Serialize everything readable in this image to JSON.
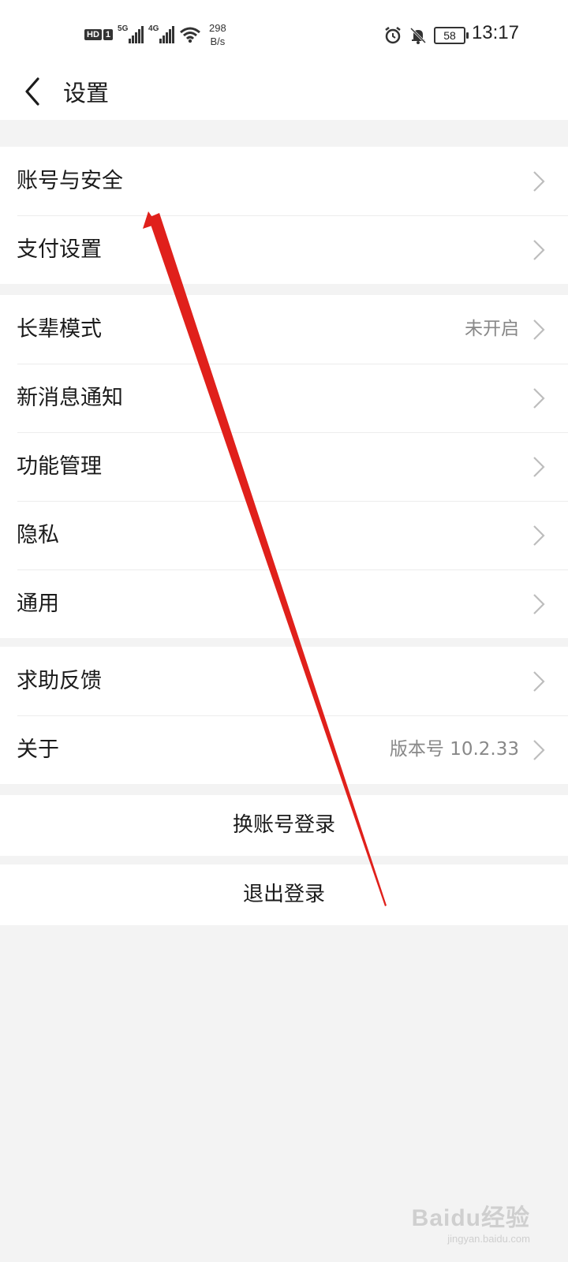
{
  "status_bar": {
    "hd": "HD",
    "sim": "1",
    "net1": "5G",
    "net2": "4G",
    "speed_value": "298",
    "speed_unit": "B/s",
    "battery": "58",
    "time": "13:17"
  },
  "header": {
    "title": "设置"
  },
  "groups": [
    {
      "items": [
        {
          "label": "账号与安全",
          "value": ""
        },
        {
          "label": "支付设置",
          "value": ""
        }
      ]
    },
    {
      "items": [
        {
          "label": "长辈模式",
          "value": "未开启"
        },
        {
          "label": "新消息通知",
          "value": ""
        },
        {
          "label": "功能管理",
          "value": ""
        },
        {
          "label": "隐私",
          "value": ""
        },
        {
          "label": "通用",
          "value": ""
        }
      ]
    },
    {
      "items": [
        {
          "label": "求助反馈",
          "value": ""
        },
        {
          "label": "关于",
          "value": "版本号 10.2.33"
        }
      ]
    }
  ],
  "buttons": {
    "switch_account": "换账号登录",
    "logout": "退出登录"
  },
  "annotation": {
    "arrow_color": "#e0201b"
  },
  "watermark": {
    "main": "Baidu经验",
    "sub": "jingyan.baidu.com"
  }
}
